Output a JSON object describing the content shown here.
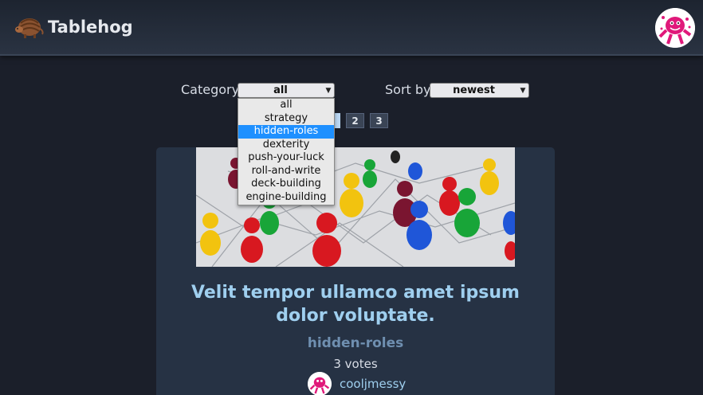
{
  "header": {
    "brand": "Tablehog",
    "logo_icon": "armadillo-icon",
    "avatar_icon": "pink-monster-avatar"
  },
  "filters": {
    "category_label": "Category:",
    "category_value": "all",
    "category_options": [
      "all",
      "strategy",
      "hidden-roles",
      "dexterity",
      "push-your-luck",
      "roll-and-write",
      "deck-building",
      "engine-building"
    ],
    "highlighted_option": "hidden-roles",
    "sort_label": "Sort by:",
    "sort_value": "newest"
  },
  "pager": {
    "pages": [
      "1",
      "2",
      "3"
    ],
    "current": "1"
  },
  "post": {
    "image_alt": "colorful game pawns on network board",
    "title": "Velit tempor ullamco amet ipsum dolor voluptate.",
    "category": "hidden-roles",
    "votes": "3 votes",
    "author": "cooljmessy"
  },
  "colors": {
    "background": "#1b1f2a",
    "card": "#263244",
    "title": "#9fcfef",
    "highlight": "#1e90ff"
  }
}
